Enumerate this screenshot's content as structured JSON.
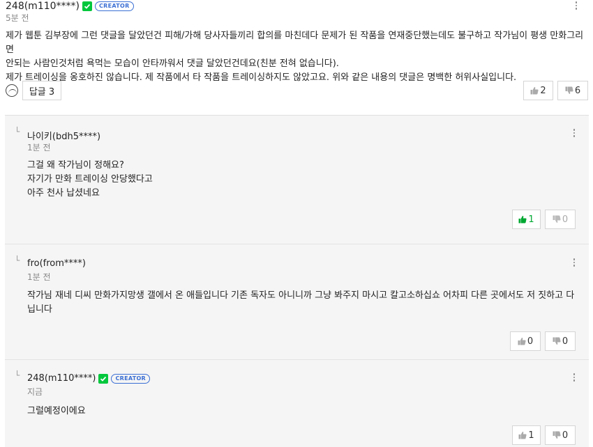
{
  "main_comment": {
    "author": "248(m110****)",
    "badge": "CREATOR",
    "time": "5분 전",
    "body": "제가 웹툰 김부장에 그런 댓글을 달았던건 피해/가해 당사자들끼리 합의를 마친데다 문제가 된 작품을 연재중단했는데도 불구하고 작가님이 평생 만화그리면\n안되는 사람인것처럼 욕먹는 모습이 안타까워서 댓글 달았던건데요(친분 전혀 없습니다).\n제가 트레이싱을 옹호하진 않습니다. 제 작품에서 타 작품을 트레이싱하지도 않았고요. 위와 같은 내용의 댓글은 명백한 허위사실입니다.",
    "reply_button": "답글 3",
    "likes": "2",
    "dislikes": "6"
  },
  "replies": [
    {
      "author": "나이키(bdh5****)",
      "time": "1분 전",
      "body": "그걸 왜 작가님이 정해요?\n자기가 만화 트레이싱 안당했다고\n아주 천사 납셨네요",
      "likes": "1",
      "dislikes": "0",
      "liked": true
    },
    {
      "author": "fro(from****)",
      "time": "1분 전",
      "body": "작가님 재네 디씨 만화가지망생 갤에서 온 애들입니다 기존 독자도 아니니까 그냥 봐주지 마시고 칼고소하십쇼 어차피 다른 곳에서도 저 짓하고 다\n닙니다",
      "likes": "0",
      "dislikes": "0",
      "liked": false
    },
    {
      "author": "248(m110****)",
      "badge": "CREATOR",
      "time": "지금",
      "body": "그럴예정이에요",
      "likes": "1",
      "dislikes": "0",
      "liked": false
    }
  ],
  "icons": {
    "like": "thumbs-up-icon",
    "dislike": "thumbs-down-icon",
    "more": "more-vertical-icon",
    "verified": "check-icon"
  },
  "colors": {
    "accent_green": "#00c73c",
    "creator_blue": "#3b6fd4"
  }
}
